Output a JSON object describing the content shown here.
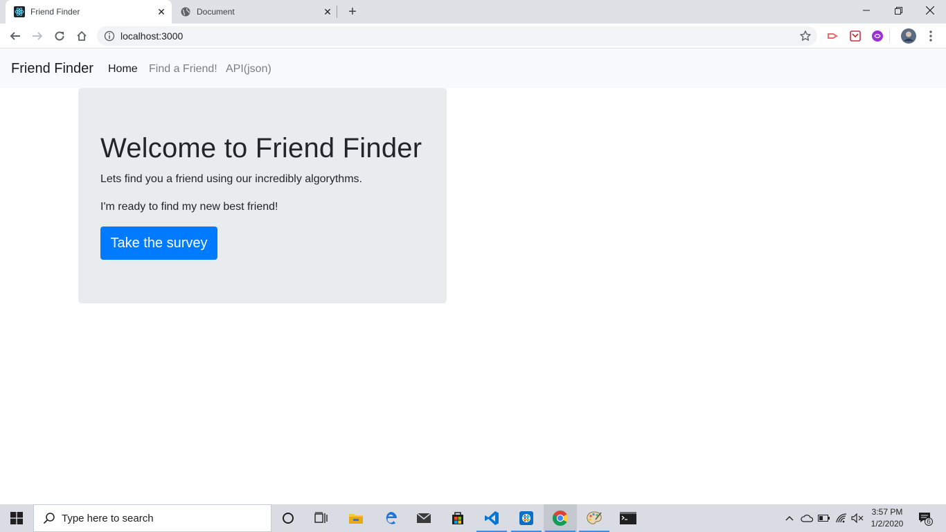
{
  "browser": {
    "tabs": [
      {
        "title": "Friend Finder",
        "favicon": "react-icon",
        "active": true
      },
      {
        "title": "Document",
        "favicon": "globe-icon",
        "active": false
      }
    ],
    "new_tab_label": "+",
    "url": "localhost:3000"
  },
  "site": {
    "brand": "Friend Finder",
    "nav": [
      {
        "label": "Home",
        "active": true
      },
      {
        "label": "Find a Friend!",
        "active": false
      },
      {
        "label": "API(json)",
        "active": false
      }
    ]
  },
  "jumbotron": {
    "heading": "Welcome to Friend Finder",
    "lead": "Lets find you a friend using our incredibly algorythms.",
    "cta_text": "I'm ready to find my new best friend!",
    "button_label": "Take the survey"
  },
  "taskbar": {
    "search_placeholder": "Type here to search",
    "time": "3:57 PM",
    "date": "1/2/2020",
    "notification_count": "6"
  },
  "colors": {
    "primary": "#007bff",
    "jumbotron_bg": "#e9ecef",
    "navbar_bg": "#f8f9fa"
  }
}
